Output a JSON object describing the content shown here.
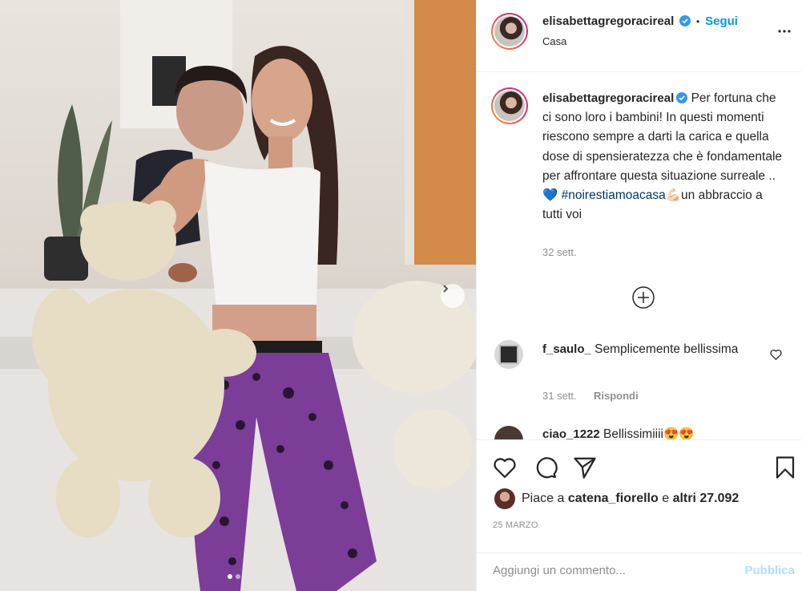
{
  "post": {
    "username": "elisabettagregoracireal",
    "follow_label": "Segui",
    "separator": "•",
    "location": "Casa",
    "carousel": {
      "current": 1,
      "total": 2
    }
  },
  "caption": {
    "username": "elisabettagregoracireal",
    "text_before": "Per fortuna che ci sono loro i bambini! In questi momenti riescono sempre a darti la carica e quella dose di spensieratezza che è fondamentale per affrontare questa situazione surreale ..",
    "heart": "💙",
    "hashtag": "#noirestiamoacasa",
    "flex": "💪🏻",
    "text_after": "un abbraccio a tutti voi",
    "time": "32 sett."
  },
  "comments": [
    {
      "username": "f_saulo_",
      "text": "Semplicemente bellissima",
      "time": "31 sett.",
      "reply_label": "Rispondi"
    },
    {
      "username": "ciao_1222",
      "text": "Bellissimiiii😍😍"
    }
  ],
  "likes": {
    "prefix": "Piace a",
    "first_user": "catena_fiorello",
    "conjunction": "e",
    "others": "altri 27.092"
  },
  "date": "25 MARZO",
  "add_comment": {
    "placeholder": "Aggiungi un commento...",
    "publish_label": "Pubblica"
  },
  "colors": {
    "accent": "#0095f6",
    "hashtag": "#00376b",
    "muted": "#8e8e8e",
    "publish_disabled": "#b2dffc"
  }
}
